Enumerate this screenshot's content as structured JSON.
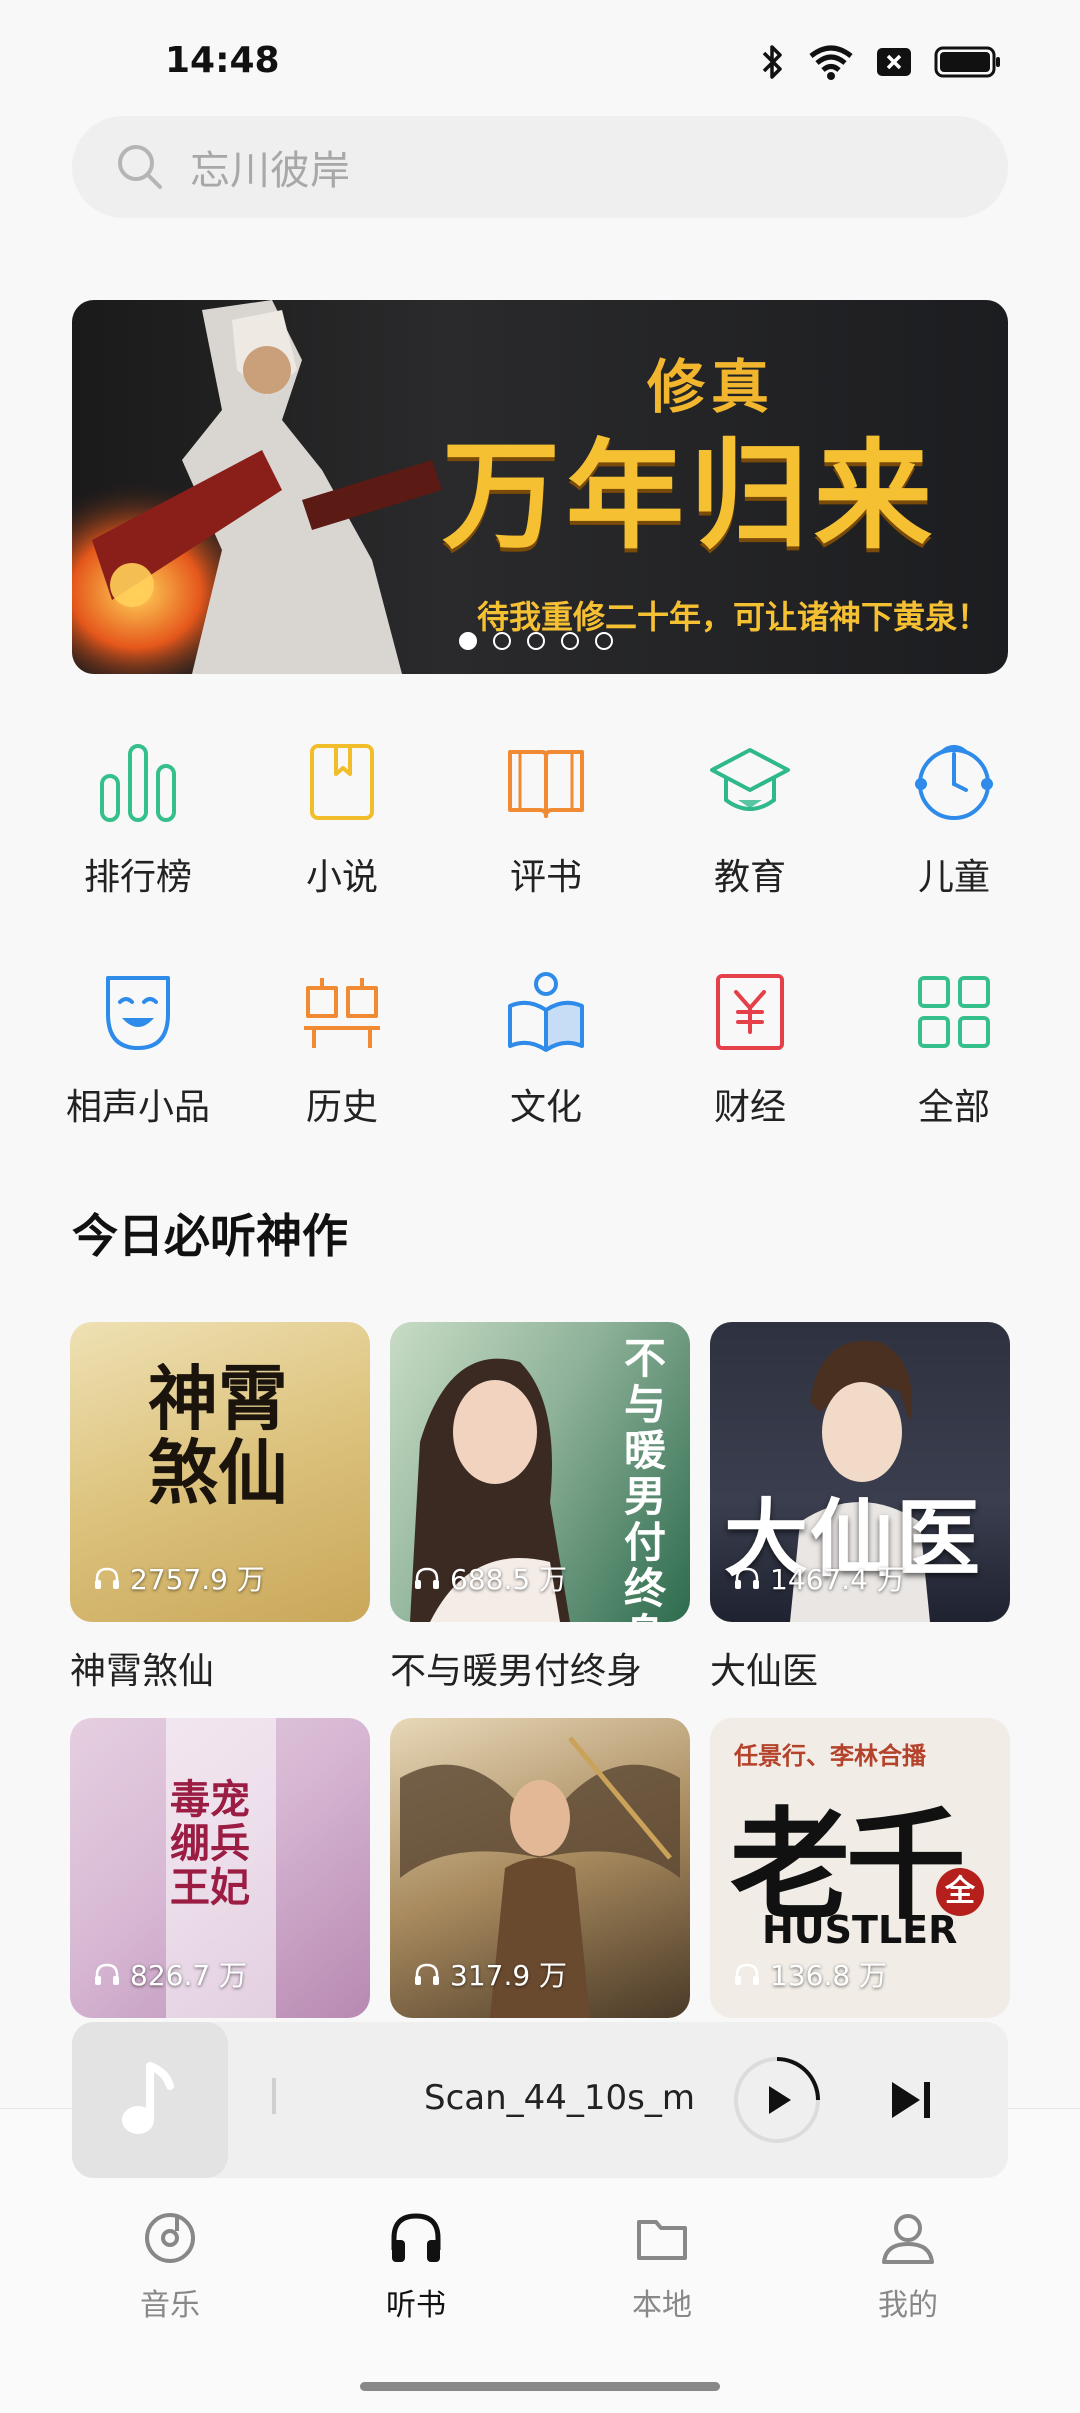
{
  "status_bar": {
    "time": "14:48",
    "icons": [
      "bluetooth-icon",
      "wifi-icon",
      "sim-icon",
      "battery-icon"
    ]
  },
  "search": {
    "placeholder": "忘川彼岸"
  },
  "banner": {
    "subtitle": "修真",
    "title": "万年归来",
    "tagline": "待我重修二十年，可让诸神下黄泉！",
    "page_count": 5,
    "active_index": 0
  },
  "categories": [
    {
      "label": "排行榜",
      "icon": "bar-chart-icon",
      "color": "#35c08b"
    },
    {
      "label": "小说",
      "icon": "book-bookmark-icon",
      "color": "#f2bd2b"
    },
    {
      "label": "评书",
      "icon": "open-book-icon",
      "color": "#f08a33"
    },
    {
      "label": "教育",
      "icon": "graduation-cap-icon",
      "color": "#2eb88b"
    },
    {
      "label": "儿童",
      "icon": "child-face-icon",
      "color": "#2e8bea"
    },
    {
      "label": "相声小品",
      "icon": "mask-icon",
      "color": "#2e8bea"
    },
    {
      "label": "历史",
      "icon": "history-building-icon",
      "color": "#f08a33"
    },
    {
      "label": "文化",
      "icon": "culture-book-icon",
      "color": "#2e8bea"
    },
    {
      "label": "财经",
      "icon": "yuan-icon",
      "color": "#e5404a"
    },
    {
      "label": "全部",
      "icon": "grid-icon",
      "color": "#35c08b"
    }
  ],
  "section": {
    "title": "今日必听神作"
  },
  "books": [
    {
      "title": "神霄煞仙",
      "plays": "2757.9 万",
      "cover_text": "神霄煞仙"
    },
    {
      "title": "不与暖男付终身",
      "plays": "688.5 万",
      "cover_text": "不与暖男付终身"
    },
    {
      "title": "大仙医",
      "plays": "1467.4 万",
      "cover_text": "大仙医"
    },
    {
      "title": "",
      "plays": "826.7 万",
      "cover_text": "毒宠绷兵王妃"
    },
    {
      "title": "",
      "plays": "317.9 万",
      "cover_text": ""
    },
    {
      "title": "",
      "plays": "136.8 万",
      "cover_text": "老千",
      "cover_sub": "任景行、李林合播",
      "cover_en": "HUSTLER",
      "cover_badge": "全"
    }
  ],
  "player": {
    "track": "Scan_44_10s_m_"
  },
  "bottom_nav": [
    {
      "label": "音乐",
      "icon": "music-disc-icon",
      "active": false
    },
    {
      "label": "听书",
      "icon": "headphones-icon",
      "active": true
    },
    {
      "label": "本地",
      "icon": "folder-icon",
      "active": false
    },
    {
      "label": "我的",
      "icon": "user-icon",
      "active": false
    }
  ]
}
